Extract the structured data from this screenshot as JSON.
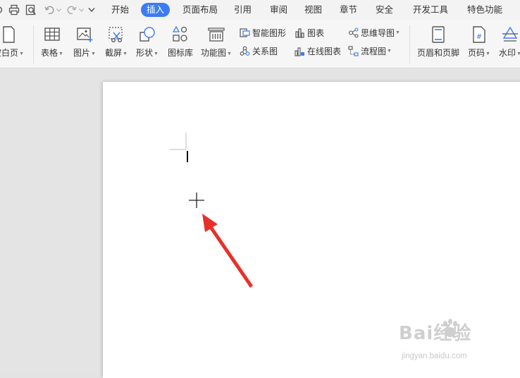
{
  "title_bar": {
    "tabs": [
      {
        "label": "开始"
      },
      {
        "label": "插入"
      },
      {
        "label": "页面布局"
      },
      {
        "label": "引用"
      },
      {
        "label": "审阅"
      },
      {
        "label": "视图"
      },
      {
        "label": "章节"
      },
      {
        "label": "安全"
      },
      {
        "label": "开发工具"
      },
      {
        "label": "特色功能"
      }
    ],
    "active_tab": "插入"
  },
  "ribbon": {
    "blank_page": "空白页",
    "table": "表格",
    "picture": "图片",
    "screenshot": "截屏",
    "shape": "形状",
    "icon_library": "图标库",
    "function_chart": "功能图",
    "smart_shape": "智能图形",
    "chart": "图表",
    "relation_chart": "关系图",
    "online_chart": "在线图表",
    "mind_map": "思维导图",
    "flow_chart": "流程图",
    "header_footer": "页眉和页脚",
    "page_number": "页码",
    "watermark": "水印",
    "page_number_glyph": "#"
  },
  "colors": {
    "accent": "#3c7cf0",
    "arrow": "#e8302a",
    "canvas": "#e4e4e4"
  },
  "watermark": {
    "brand": "Bai经验",
    "url": "jingyan.baidu.com"
  }
}
